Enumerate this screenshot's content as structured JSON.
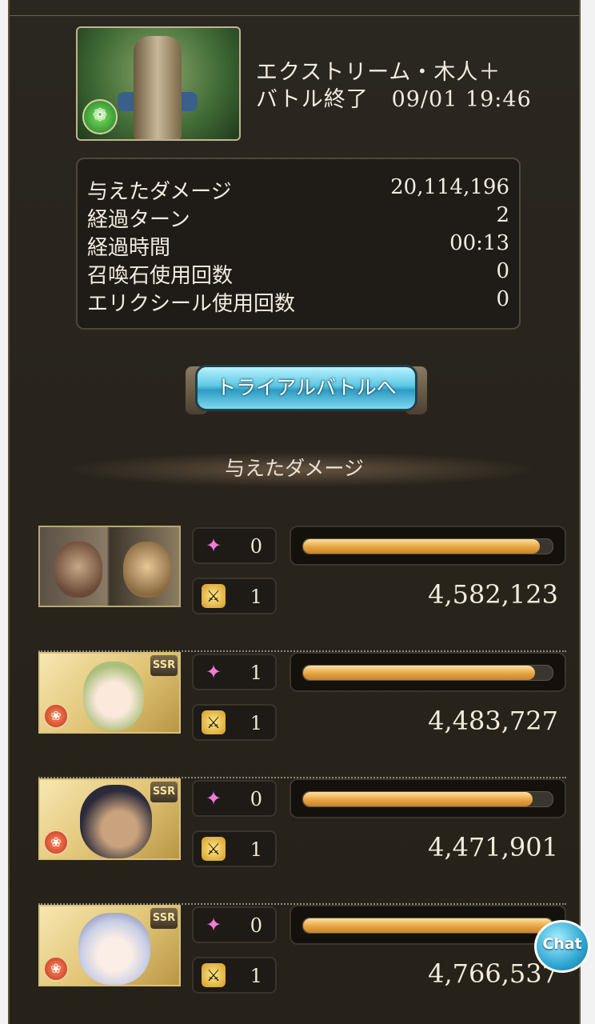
{
  "quest": {
    "title": "エクストリーム・木人＋",
    "status": "バトル終了",
    "datetime": "09/01 19:46",
    "element_icon": "wind-element-icon"
  },
  "stats": [
    {
      "label": "与えたダメージ",
      "value": "20,114,196"
    },
    {
      "label": "経過ターン",
      "value": "2"
    },
    {
      "label": "経過時間",
      "value": "00:13"
    },
    {
      "label": "召喚石使用回数",
      "value": "0"
    },
    {
      "label": "エリクシール使用回数",
      "value": "0"
    }
  ],
  "trial_button": {
    "label": "トライアルバトルへ"
  },
  "damage_section": {
    "title": "与えたダメージ"
  },
  "characters": [
    {
      "rarity": "",
      "element": "",
      "skill_uses": "0",
      "ca_uses": "1",
      "damage": "4,582,123",
      "bar_fill": 0.95
    },
    {
      "rarity": "SSR",
      "element": "fire",
      "skill_uses": "1",
      "ca_uses": "1",
      "damage": "4,483,727",
      "bar_fill": 0.93
    },
    {
      "rarity": "SSR",
      "element": "fire",
      "skill_uses": "0",
      "ca_uses": "1",
      "damage": "4,471,901",
      "bar_fill": 0.92
    },
    {
      "rarity": "SSR",
      "element": "fire",
      "skill_uses": "0",
      "ca_uses": "1",
      "damage": "4,766,537",
      "bar_fill": 1.0
    }
  ],
  "icons": {
    "skill": "sparkle-icon",
    "ca": "crossed-swords-icon"
  },
  "chat": {
    "label": "Chat"
  },
  "colors": {
    "bar": "#e6a441",
    "button": "#5cc7e4",
    "panel": "#2a2620"
  }
}
